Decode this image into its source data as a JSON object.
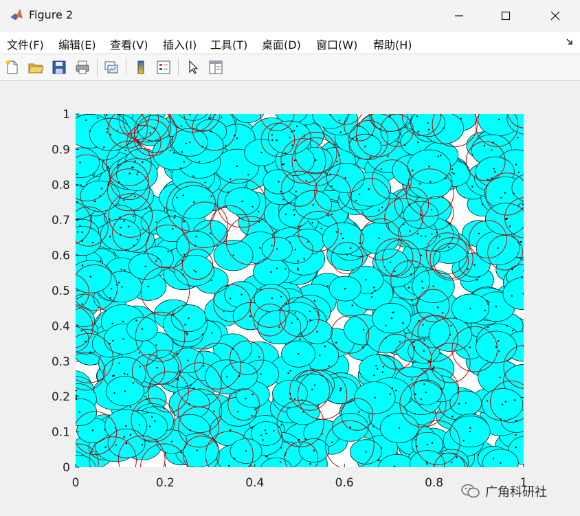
{
  "window": {
    "title": "Figure 2",
    "controls": {
      "minimize": "minimize",
      "maximize": "maximize",
      "close": "close"
    }
  },
  "menu": {
    "items": [
      "文件(F)",
      "编辑(E)",
      "查看(V)",
      "插入(I)",
      "工具(T)",
      "桌面(D)",
      "窗口(W)",
      "帮助(H)"
    ]
  },
  "toolbar": {
    "buttons": [
      "new-figure-icon",
      "open-file-icon",
      "save-icon",
      "print-icon",
      "link-plot-icon",
      "colorbar-icon",
      "legend-icon",
      "edit-plot-icon",
      "property-editor-icon"
    ]
  },
  "chart_data": {
    "type": "scatter",
    "title": "",
    "xlabel": "",
    "ylabel": "",
    "xlim": [
      0,
      1
    ],
    "ylim": [
      0,
      1
    ],
    "xticks": [
      "0",
      "0.2",
      "0.4",
      "0.6",
      "0.8",
      "1"
    ],
    "yticks": [
      "0",
      "0.1",
      "0.2",
      "0.3",
      "0.4",
      "0.5",
      "0.6",
      "0.7",
      "0.8",
      "0.9",
      "1"
    ],
    "fill_color": "#00ffff",
    "edge_color": "#000000",
    "overlay_color": "#cc0000",
    "grid": false,
    "series": [
      {
        "values": []
      }
    ]
  },
  "watermark": {
    "text": "广角科研社"
  }
}
